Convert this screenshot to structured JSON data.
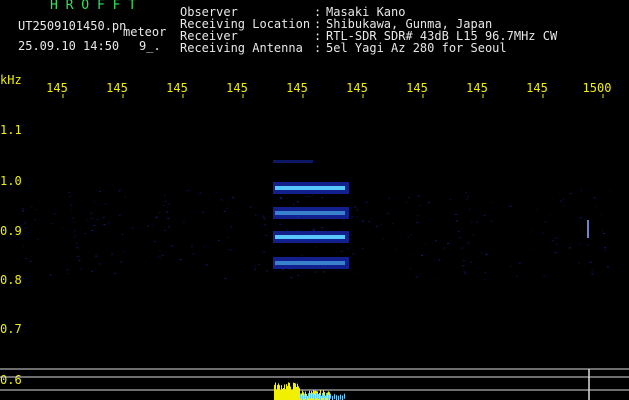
{
  "header": {
    "app_name": "H R O F F T",
    "filename": "UT2509101450.pn",
    "mode_label": "meteor",
    "datetime": "25.09.10 14:50",
    "counter": "9_.",
    "fields": [
      {
        "label": "Observer",
        "sep": ":",
        "value": "Masaki Kano"
      },
      {
        "label": "Receiving Location",
        "sep": ":",
        "value": "Shibukawa, Gunma, Japan"
      },
      {
        "label": "Receiver",
        "sep": ":",
        "value": "RTL-SDR SDR# 43dB L15 96.7MHz CW"
      },
      {
        "label": "Receiving Antenna",
        "sep": ":",
        "value": "5el Yagi Az 280 for Seoul"
      }
    ]
  },
  "spectrogram": {
    "unit_label": "kHz",
    "time_ticks": [
      "145",
      "145",
      "145",
      "145",
      "145",
      "145",
      "145",
      "145",
      "145",
      "1500"
    ],
    "freq_ticks": [
      "1.1",
      "1.0",
      "0.9",
      "0.8",
      "0.7",
      "0.6"
    ],
    "colors": {
      "text": "#e8e8e8",
      "tick_labels": "#f0f000",
      "app_name": "#2ee65a",
      "marker_line": "#dcdcdc",
      "echo_core": "#5cd2ff",
      "echo_edge": "#1f3bff",
      "level_trace": "#f0f000"
    }
  }
}
